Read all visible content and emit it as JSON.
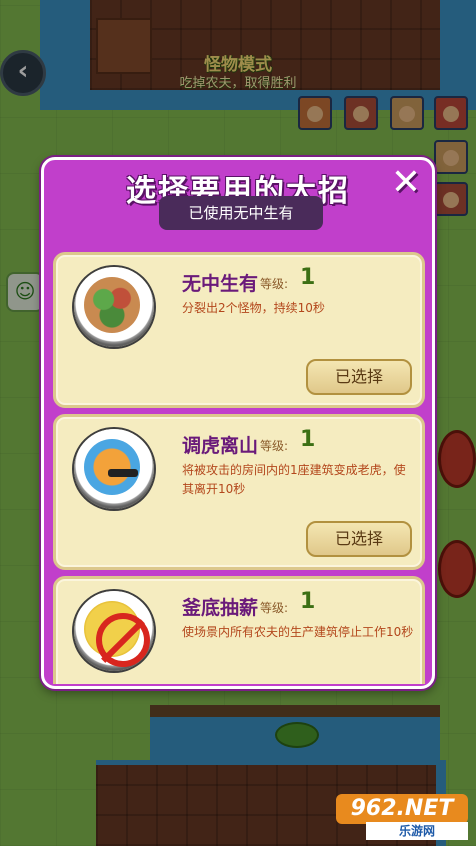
{
  "background": {
    "mode_title": "怪物模式",
    "mode_subtitle": "吃掉农夫，取得胜利",
    "back_icon": "chevron-left-icon",
    "chat_icon": "chat-bubble-icon"
  },
  "dialog": {
    "title": "选择要用的大招",
    "close_icon": "close-icon",
    "used_label": "已使用无中生有",
    "accent_color": "#c13fcb",
    "skills": [
      {
        "name": "无中生有",
        "level_label": "等级:",
        "level": "1",
        "description": "分裂出2个怪物，持续10秒",
        "button_label": "已选择",
        "icon": "zombie-clone-icon"
      },
      {
        "name": "调虎离山",
        "level_label": "等级:",
        "level": "1",
        "description": "将被攻击的房间内的1座建筑变成老虎，使其离开10秒",
        "button_label": "已选择",
        "icon": "tiger-icon"
      },
      {
        "name": "釜底抽薪",
        "level_label": "等级:",
        "level": "1",
        "description": "使场景内所有农夫的生产建筑停止工作10秒",
        "icon": "no-production-icon"
      }
    ]
  },
  "watermark": {
    "logo": "962.NET",
    "subtitle": "乐游网"
  }
}
